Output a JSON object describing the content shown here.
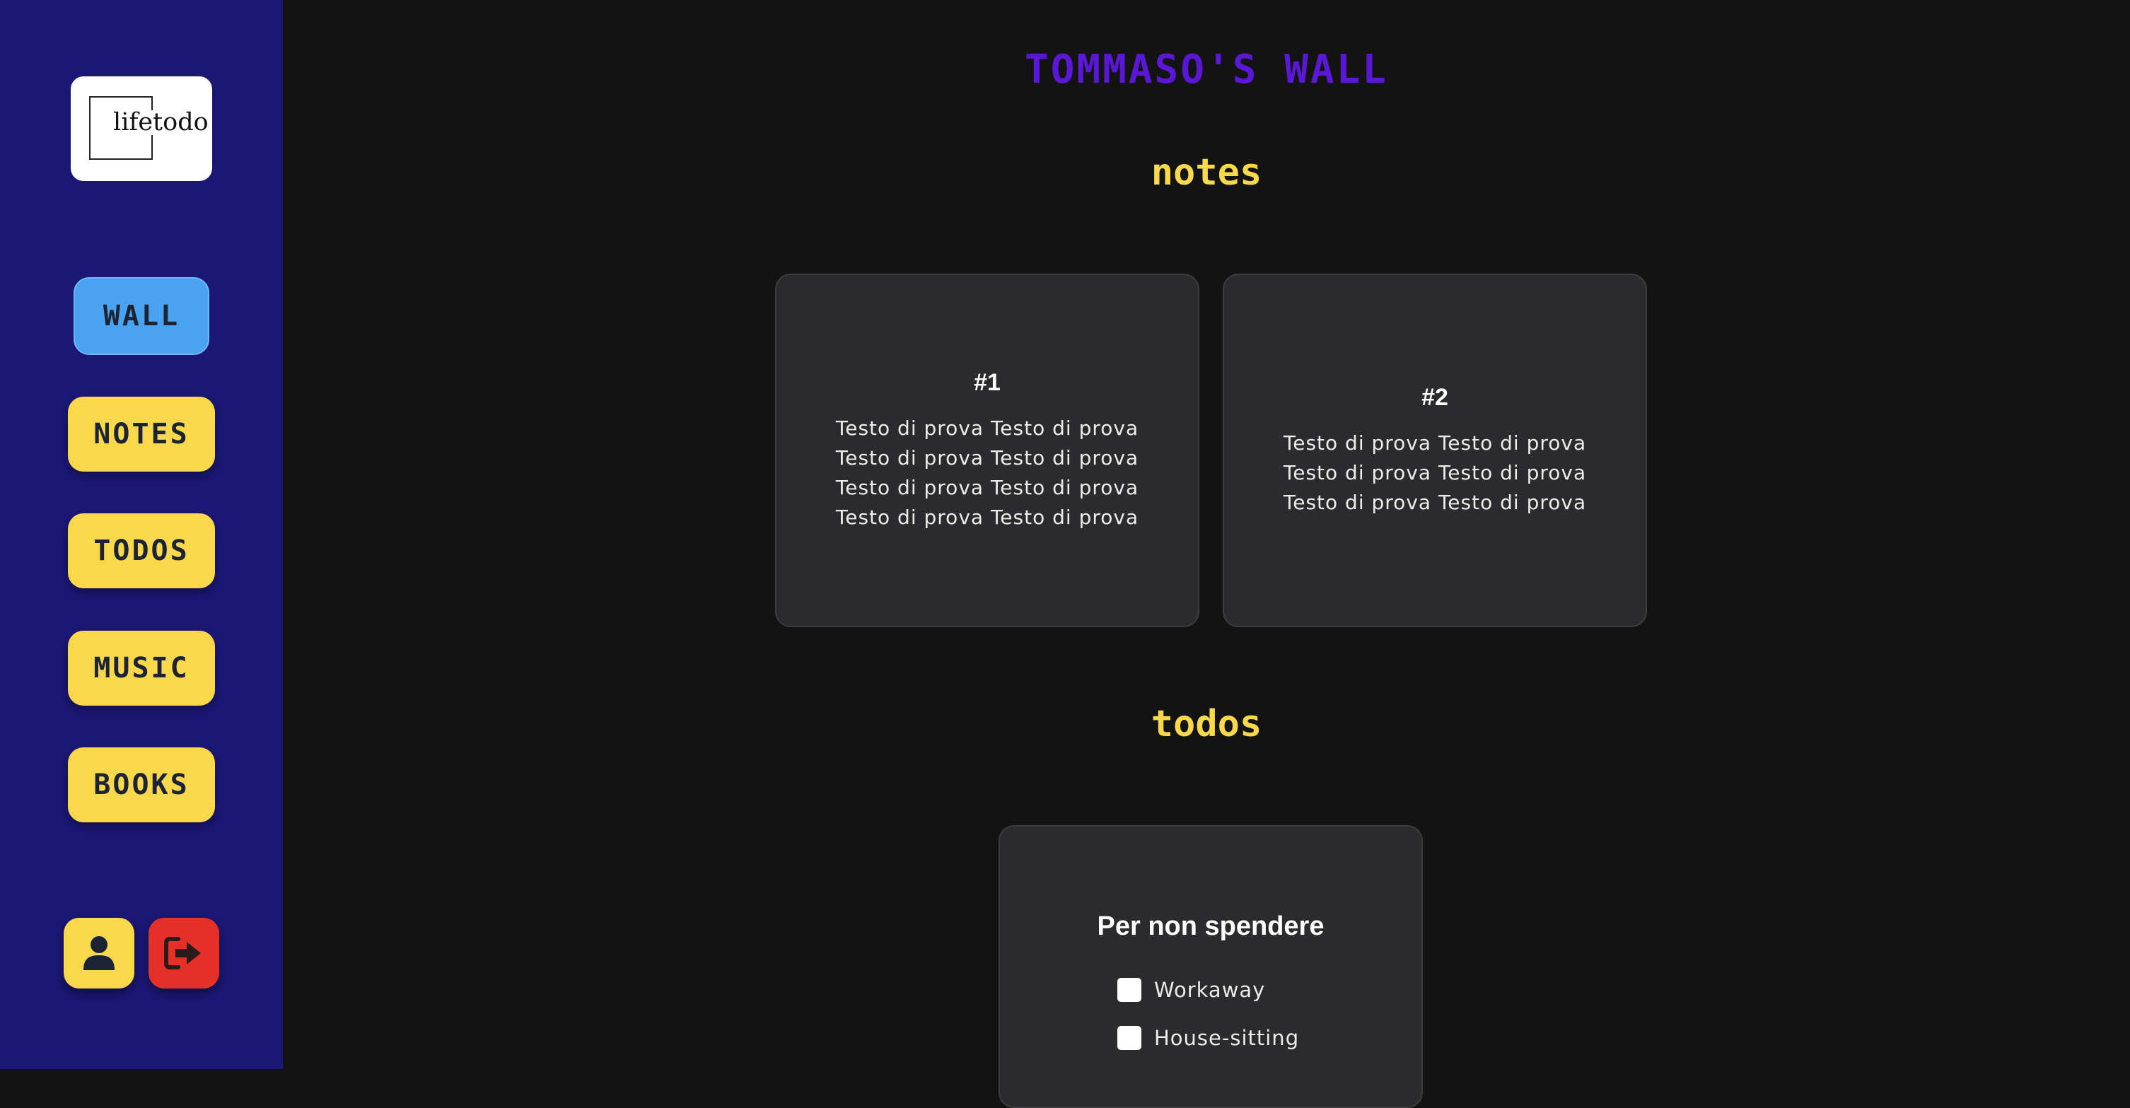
{
  "sidebar": {
    "logo_text": "lifetodo",
    "nav": [
      {
        "label": "WALL",
        "active": true
      },
      {
        "label": "NOTES",
        "active": false
      },
      {
        "label": "TODOS",
        "active": false
      },
      {
        "label": "MUSIC",
        "active": false
      },
      {
        "label": "BOOKS",
        "active": false
      }
    ],
    "profile_icon": "user-icon",
    "logout_icon": "logout-icon"
  },
  "main": {
    "title": "TOMMASO'S WALL",
    "notes_heading": "notes",
    "notes": [
      {
        "title": "#1",
        "body": "Testo di prova Testo di prova Testo di prova Testo di prova Testo di prova Testo di prova Testo di prova Testo di prova"
      },
      {
        "title": "#2",
        "body": "Testo di prova Testo di prova Testo di prova Testo di prova Testo di prova Testo di prova"
      }
    ],
    "todos_heading": "todos",
    "todo_list": {
      "title": "Per non spendere",
      "items": [
        {
          "label": "Workaway",
          "checked": false
        },
        {
          "label": "House-sitting",
          "checked": false
        }
      ]
    }
  },
  "colors": {
    "sidebar_bg": "#1b1775",
    "page_bg": "#131313",
    "title": "#5a18d6",
    "accent_yellow": "#f9d84c",
    "active_blue": "#4aa3f0",
    "logout_red": "#e5302a",
    "card_bg": "#2b2b2d"
  }
}
